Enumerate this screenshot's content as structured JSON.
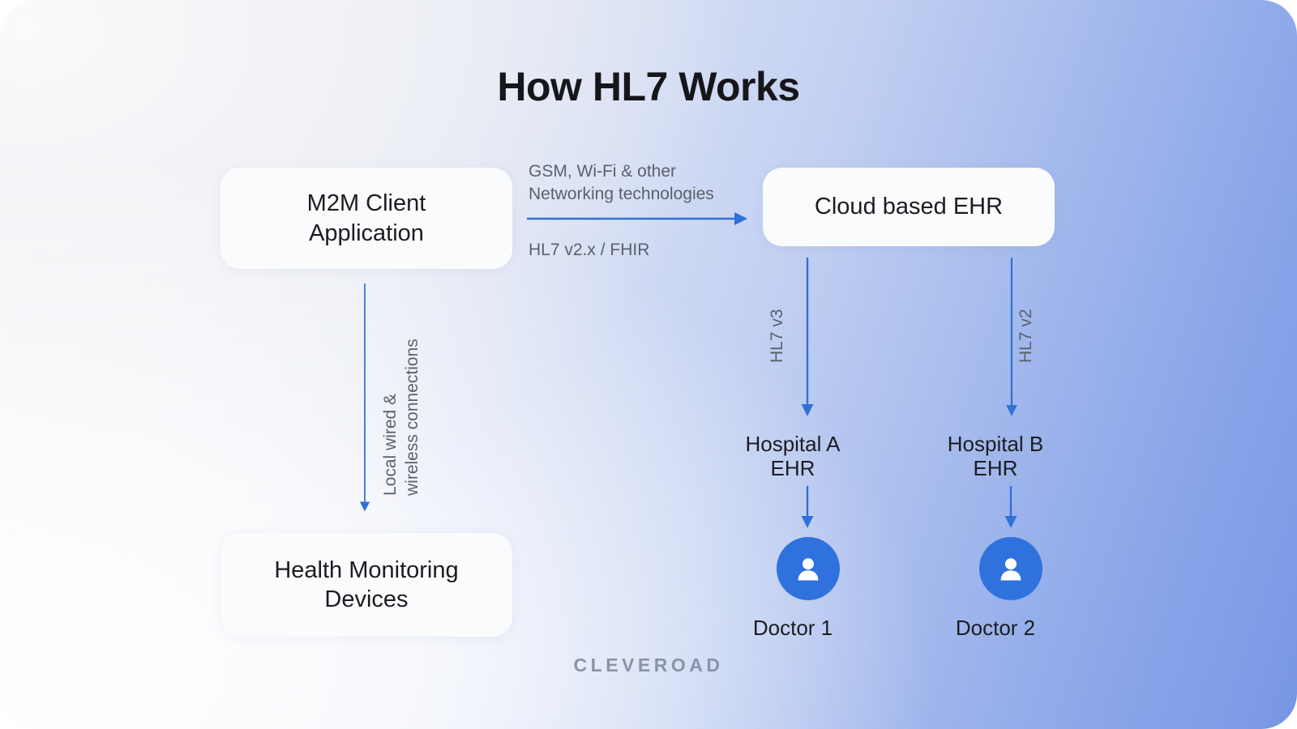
{
  "page": {
    "title": "How HL7 Works",
    "wordmark": "CLEVEROAD",
    "accent_blue": "#2f6fd8",
    "avatar_blue": "#2f71dd",
    "card_bg": "#fafbfc",
    "title_color": "#15161a",
    "edge_label_color": "#595f6b"
  },
  "nodes": {
    "m2m_client": "M2M Client\nApplication",
    "health_devices": "Health Monitoring\nDevices",
    "cloud_ehr": "Cloud based EHR",
    "hospital_a": "Hospital A\nEHR",
    "hospital_b": "Hospital B\nEHR",
    "doctor_1": "Doctor 1",
    "doctor_2": "Doctor 2"
  },
  "edges": {
    "m2m_to_cloud_top": "GSM, Wi-Fi & other\nNetworking technologies",
    "m2m_to_cloud_bottom": "HL7 v2.x / FHIR",
    "m2m_to_devices": "Local wired &\nwireless connections",
    "cloud_to_hospital_a": "HL7 v3",
    "cloud_to_hospital_b": "HL7 v2"
  },
  "icons": {
    "doctor_avatar": "person-icon",
    "arrow": "arrow-icon"
  }
}
